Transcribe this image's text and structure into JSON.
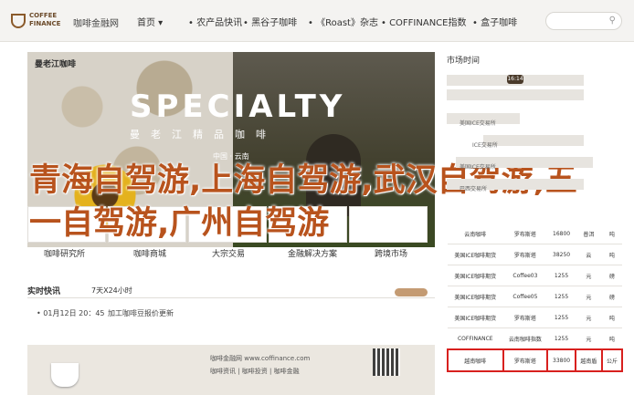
{
  "header": {
    "logo_lines": [
      "COFFEE",
      "FINANCE"
    ],
    "site_name": "咖啡金融网",
    "nav": [
      "首页 ▾",
      "• 农产品快讯",
      "• 黑谷子咖啡",
      "• 《Roast》杂志",
      "• COFFINANCE指数",
      "• 盒子咖啡"
    ]
  },
  "banner": {
    "badge": "曼老江咖啡",
    "headline": "SPECIALTY",
    "subline": "曼老江精品咖啡",
    "origin": "中国 · 云南"
  },
  "quick_links": [
    "咖啡研究所",
    "咖啡商城",
    "大宗交易",
    "金融解决方案",
    "跨境市场"
  ],
  "overlay_text": "青海自驾游,上海自驾游,武汉自驾游,五一自驾游,广州自驾游",
  "live": {
    "title": "实时快讯",
    "subtitle": "7天X24小时",
    "item": "• 01月12日 20：45",
    "item_text": "加工咖啡豆报价更新"
  },
  "footer_banner": {
    "site": "咖啡金融网 www.coffinance.com",
    "links": "咖啡资讯 | 咖啡投资 | 咖啡金融"
  },
  "sidebar": {
    "timeline_title": "市场时间",
    "time_marker": "16:14",
    "timeline_labels": [
      "美国ICE交易所",
      "ICE交易所",
      "美国ICE交易所",
      "巴西交易所"
    ],
    "table_headers": [
      "",
      "",
      "",
      "",
      ""
    ],
    "rows": [
      [
        "云南咖啡",
        "罗布斯塔",
        "16800",
        "普洱",
        "吨"
      ],
      [
        "美国ICE咖啡期货",
        "罗布斯塔",
        "38250",
        "云",
        "吨"
      ],
      [
        "美国ICE咖啡期货",
        "Coffee03",
        "1255",
        "元",
        "磅"
      ],
      [
        "美国ICE咖啡期货",
        "Coffee05",
        "1255",
        "元",
        "磅"
      ],
      [
        "美国ICE咖啡期货",
        "罗布斯塔",
        "1255",
        "元",
        "吨"
      ],
      [
        "COFFINANCE",
        "云南咖啡指数",
        "1255",
        "元",
        "吨"
      ],
      [
        "越南咖啡",
        "罗布斯塔",
        "33800",
        "越南盾",
        "公斤"
      ]
    ]
  }
}
